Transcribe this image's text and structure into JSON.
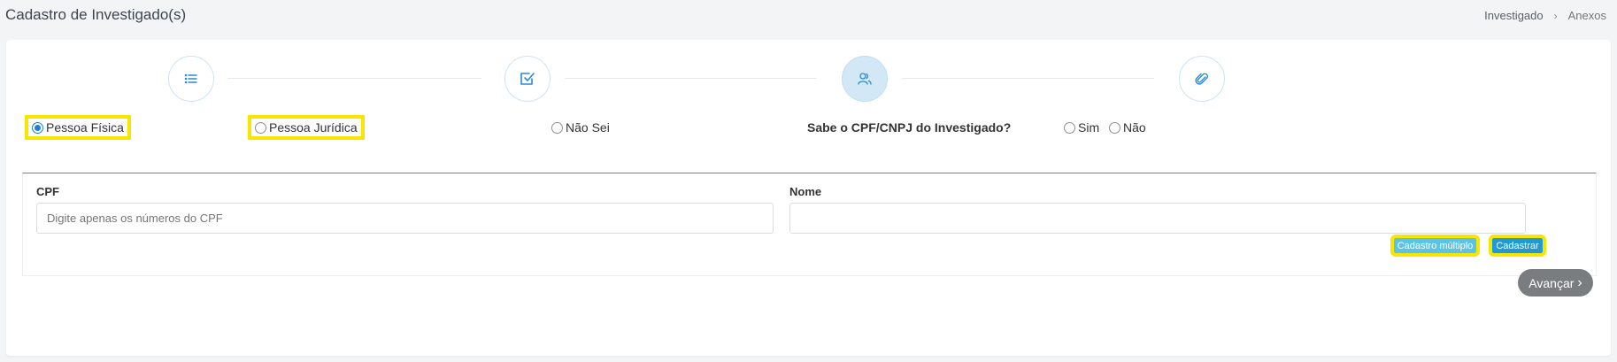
{
  "header": {
    "title": "Cadastro de Investigado(s)",
    "breadcrumb": [
      "Investigado",
      "Anexos"
    ]
  },
  "stepper": {
    "steps": [
      {
        "icon": "list-icon",
        "active": false
      },
      {
        "icon": "checkbox-icon",
        "active": false
      },
      {
        "icon": "users-icon",
        "active": true
      },
      {
        "icon": "paperclip-icon",
        "active": false
      }
    ]
  },
  "person_type": {
    "options": [
      "Pessoa Física",
      "Pessoa Jurídica",
      "Não Sei"
    ],
    "selected": "Pessoa Física"
  },
  "cpf_question": {
    "label": "Sabe o CPF/CNPJ do Investigado?",
    "options": [
      "Sim",
      "Não"
    ]
  },
  "form": {
    "cpf_label": "CPF",
    "cpf_placeholder": "Digite apenas os números do CPF",
    "cpf_value": "",
    "nome_label": "Nome",
    "nome_value": "",
    "multi_button": "Cadastro múltiplo",
    "submit_button": "Cadastrar"
  },
  "footer": {
    "next_button": "Avançar"
  },
  "colors": {
    "accent": "#1c7ed6",
    "highlight": "#f7e600",
    "next_button": "#7a7d80"
  }
}
